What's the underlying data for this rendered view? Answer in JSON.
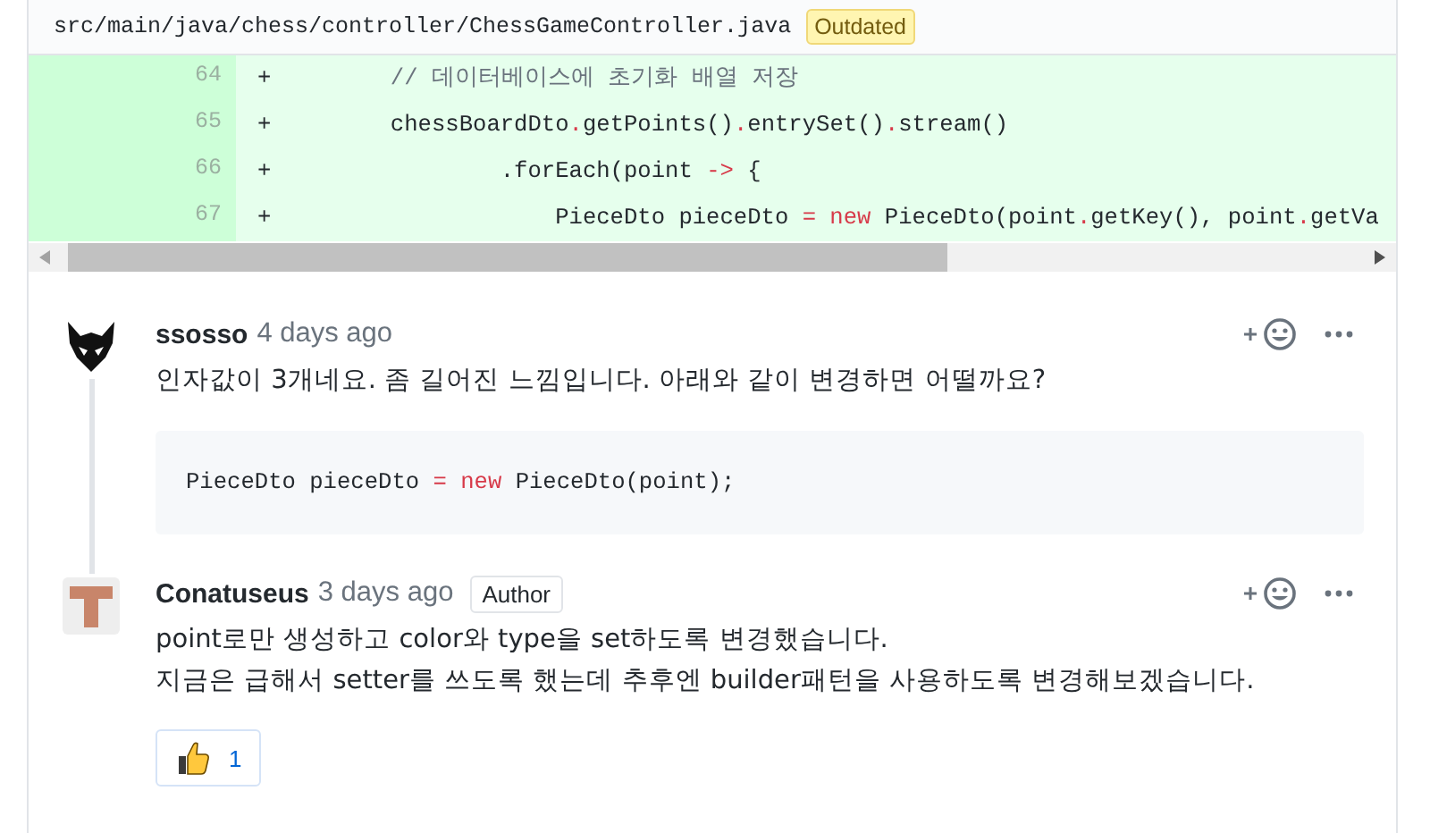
{
  "file_header": {
    "path": "src/main/java/chess/controller/ChessGameController.java",
    "badge": "Outdated"
  },
  "diff_lines": [
    {
      "number": "64",
      "sign": "+",
      "tokens": [
        {
          "text": "        // 데이터베이스에 초기화 배열 저장",
          "kind": "comment"
        }
      ]
    },
    {
      "number": "65",
      "sign": "+",
      "tokens": [
        {
          "text": "        chessBoardDto",
          "kind": "plain"
        },
        {
          "text": ".",
          "kind": "op"
        },
        {
          "text": "getPoints()",
          "kind": "plain"
        },
        {
          "text": ".",
          "kind": "op"
        },
        {
          "text": "entrySet()",
          "kind": "plain"
        },
        {
          "text": ".",
          "kind": "op"
        },
        {
          "text": "stream()",
          "kind": "plain"
        }
      ]
    },
    {
      "number": "66",
      "sign": "+",
      "tokens": [
        {
          "text": "                .forEach(point ",
          "kind": "plain"
        },
        {
          "text": "->",
          "kind": "op"
        },
        {
          "text": " {",
          "kind": "plain"
        }
      ]
    },
    {
      "number": "67",
      "sign": "+",
      "tokens": [
        {
          "text": "                    PieceDto pieceDto ",
          "kind": "plain"
        },
        {
          "text": "= new",
          "kind": "op"
        },
        {
          "text": " PieceDto(point",
          "kind": "plain"
        },
        {
          "text": ".",
          "kind": "op"
        },
        {
          "text": "getKey(), point",
          "kind": "plain"
        },
        {
          "text": ".",
          "kind": "op"
        },
        {
          "text": "getVa",
          "kind": "plain"
        }
      ]
    }
  ],
  "comments": [
    {
      "kind": "fox",
      "author": "ssosso",
      "time": "4 days ago",
      "lines": [
        "인자값이 3개네요. 좀 길어진 느낌입니다. 아래와 같이 변경하면 어떨까요?"
      ],
      "code_block": [
        {
          "text": "PieceDto pieceDto ",
          "kind": "plain"
        },
        {
          "text": "= new",
          "kind": "op"
        },
        {
          "text": " PieceDto(point);",
          "kind": "plain"
        }
      ]
    },
    {
      "kind": "letter",
      "author": "Conatuseus",
      "time": "3 days ago",
      "badge": "Author",
      "lines": [
        "point로만 생성하고 color와 type을 set하도록 변경했습니다.",
        "지금은 급해서 setter를 쓰도록 했는데 추후엔 builder패턴을 사용하도록 변경해보겠습니다."
      ],
      "reactions": [
        {
          "count": "1"
        }
      ]
    }
  ]
}
